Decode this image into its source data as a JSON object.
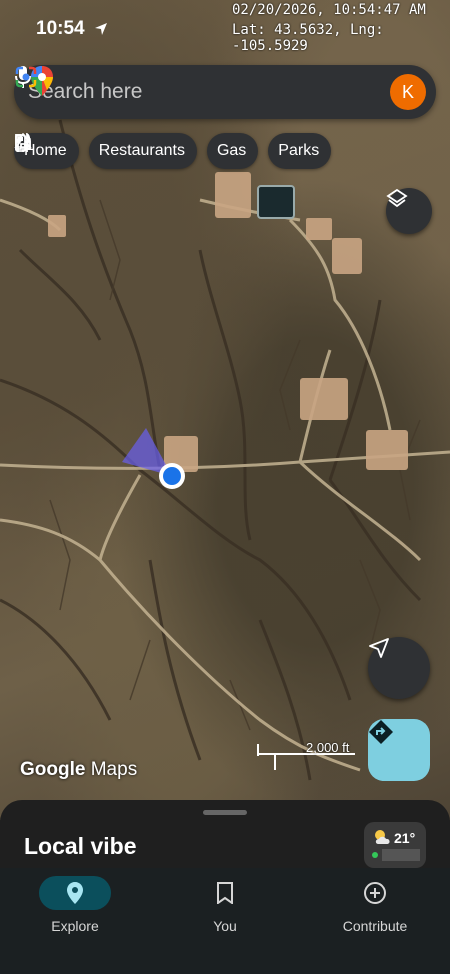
{
  "status_bar": {
    "time": "10:54"
  },
  "overlay": {
    "date_time": "02/20/2026, 10:54:47 AM",
    "coordinates": "Lat: 43.5632, Lng: -105.5929"
  },
  "search": {
    "placeholder": "Search here",
    "avatar_letter": "K"
  },
  "chips": [
    {
      "label": "Home",
      "icon": "home-icon"
    },
    {
      "label": "Restaurants",
      "icon": "restaurant-icon"
    },
    {
      "label": "Gas",
      "icon": "gas-pump-icon"
    },
    {
      "label": "Parks",
      "icon": "tree-icon"
    }
  ],
  "map": {
    "scale_label": "2,000 ft",
    "brand_google": "Google",
    "brand_maps": "Maps"
  },
  "sheet": {
    "title": "Local vibe"
  },
  "weather": {
    "temperature": "21°",
    "icon": "partly-cloudy-icon"
  },
  "nav": [
    {
      "label": "Explore",
      "icon": "location-pin-icon",
      "active": true
    },
    {
      "label": "You",
      "icon": "bookmark-icon",
      "active": false
    },
    {
      "label": "Contribute",
      "icon": "add-circle-icon",
      "active": false
    }
  ],
  "colors": {
    "accent": "#7ecfe0",
    "avatar": "#ef6c00",
    "surface": "#2f3134",
    "nav_active": "#0b4f5c"
  }
}
